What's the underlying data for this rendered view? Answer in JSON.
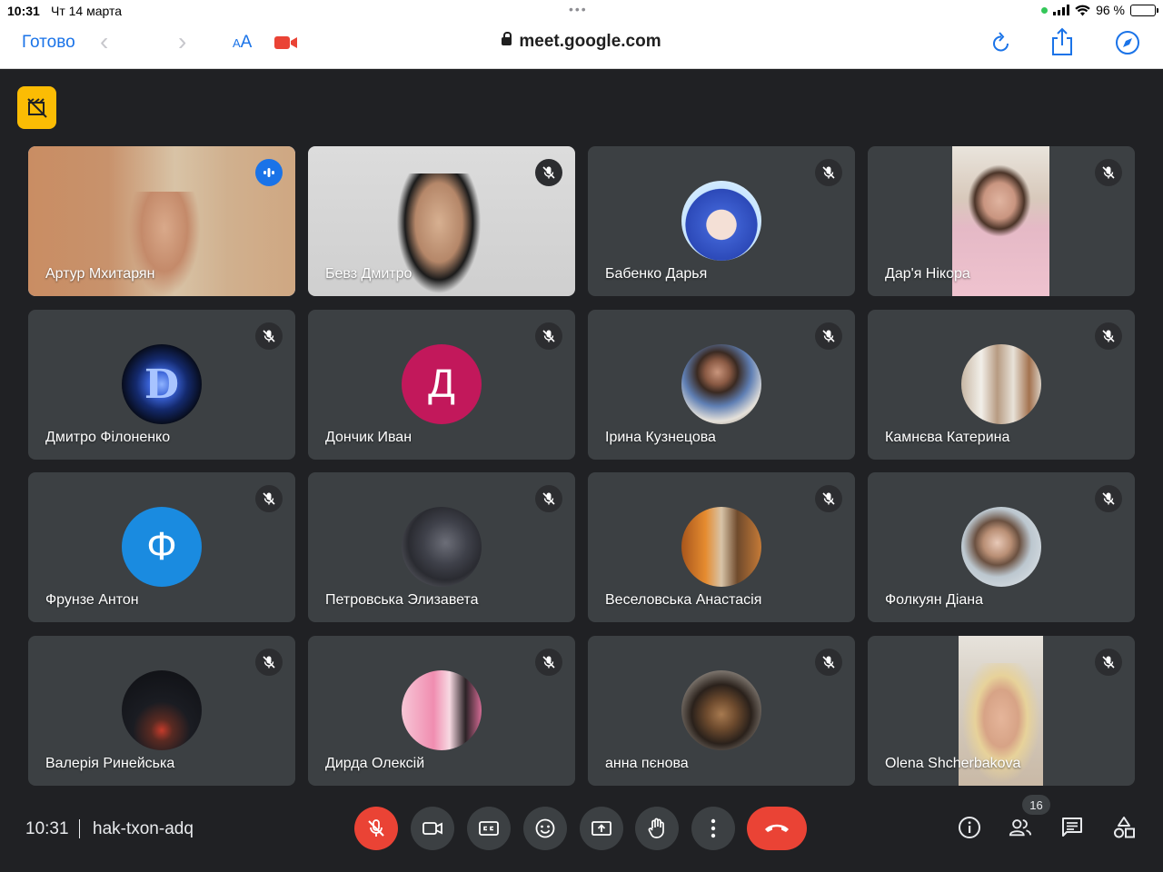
{
  "status": {
    "time": "10:31",
    "date": "Чт 14 марта",
    "battery": "96 %"
  },
  "safari": {
    "done": "Готово",
    "text_size": "AA",
    "url": "meet.google.com"
  },
  "meeting": {
    "time": "10:31",
    "code": "hak-txon-adq",
    "participants_count": "16"
  },
  "participants": [
    {
      "name": "Артур Мхитарян",
      "speaking": true
    },
    {
      "name": "Бевз Дмитро"
    },
    {
      "name": "Бабенко Дарья"
    },
    {
      "name": "Дар'я Нікора"
    },
    {
      "name": "Дмитро Філоненко"
    },
    {
      "name": "Дончик Иван",
      "initial": "Д",
      "color": "#c2185b"
    },
    {
      "name": "Ірина Кузнецова"
    },
    {
      "name": "Камнєва Катерина"
    },
    {
      "name": "Фрунзе Антон",
      "initial": "Ф",
      "color": "#1a8be0"
    },
    {
      "name": "Петровська Элизавета"
    },
    {
      "name": "Веселовська Анастасія"
    },
    {
      "name": "Фолкуян Діана"
    },
    {
      "name": "Валерія Ринейська"
    },
    {
      "name": "Дирда Олексій"
    },
    {
      "name": "анна пєнова"
    },
    {
      "name": "Olena Shcherbakova"
    }
  ],
  "colors": {
    "background": "#202124",
    "tile": "#3c4043",
    "accent": "#1a73e8",
    "danger": "#ea4335",
    "recording": "#fbbc04"
  }
}
